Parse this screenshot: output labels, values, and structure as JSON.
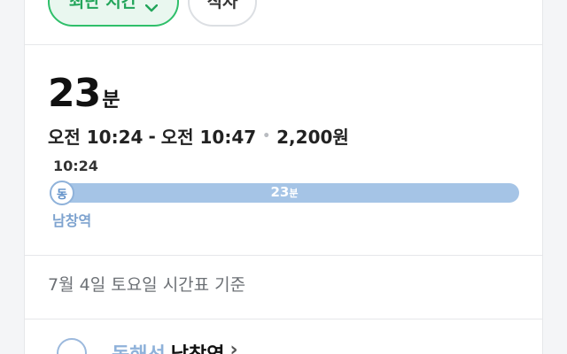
{
  "filters": {
    "active_label": "최단 시간",
    "active_icon": "chevron-down-icon",
    "inactive_label": "직자"
  },
  "summary": {
    "duration_value": "23",
    "duration_unit": "분",
    "depart_time": "오전 10:24",
    "time_separator": "-",
    "arrive_time": "오전 10:47",
    "fare_separator": "•",
    "fare": "2,200원"
  },
  "timeline": {
    "start_time": "10:24",
    "start_badge": "동",
    "segment_minutes": "23",
    "segment_unit": "분",
    "start_station": "남창역",
    "bar_color": "#a5c4e6"
  },
  "schedule_note": "7월 4일 토요일 시간표 기준",
  "next_row": {
    "line_label": "동해선",
    "station_label": "남창역",
    "arrow": "›"
  },
  "colors": {
    "accent_green": "#2fbf6a",
    "accent_blue": "#8fb2da"
  }
}
